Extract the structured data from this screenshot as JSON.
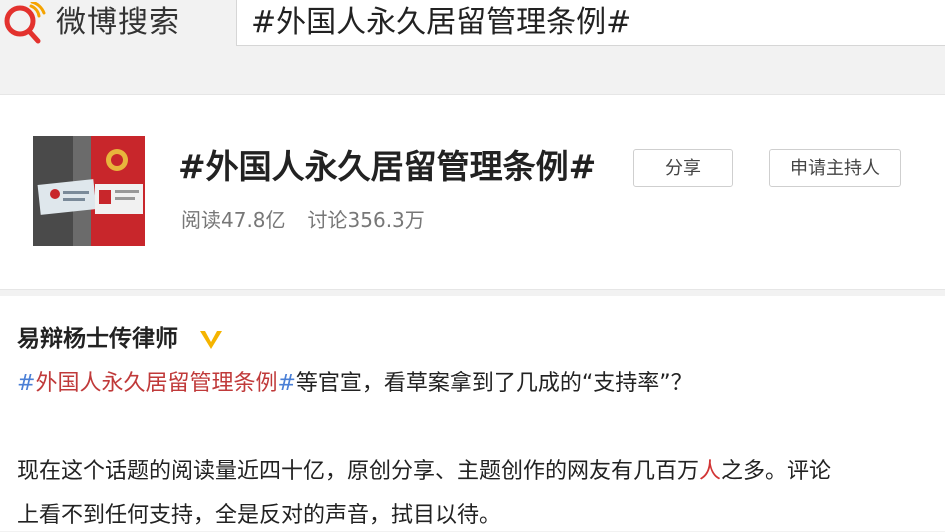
{
  "header": {
    "brand": "微博搜索",
    "search_value": "#外国人永久居留管理条例#"
  },
  "topic": {
    "title": "#外国人永久居留管理条例#",
    "reads": "阅读47.8亿",
    "discussions": "讨论356.3万",
    "share_label": "分享",
    "host_label": "申请主持人"
  },
  "post": {
    "author": "易辩杨士传律师",
    "line1": {
      "hash_open": "#",
      "topic": "外国人永久居留管理条例",
      "hash_close": "#",
      "rest": "等官宣，看草案拿到了几成的“支持率”？"
    },
    "line2": {
      "before": "现在这个话题的阅读量近四十亿，原创分享、主题创作的网友有几百万",
      "highlight": "人",
      "after": "之多。评论"
    },
    "line3": "上看不到任何支持，全是反对的声音，拭目以待。"
  },
  "colors": {
    "accent_red": "#e3322e",
    "hashtag_blue": "#4a7fd6",
    "verified_gold": "#f5b400"
  }
}
